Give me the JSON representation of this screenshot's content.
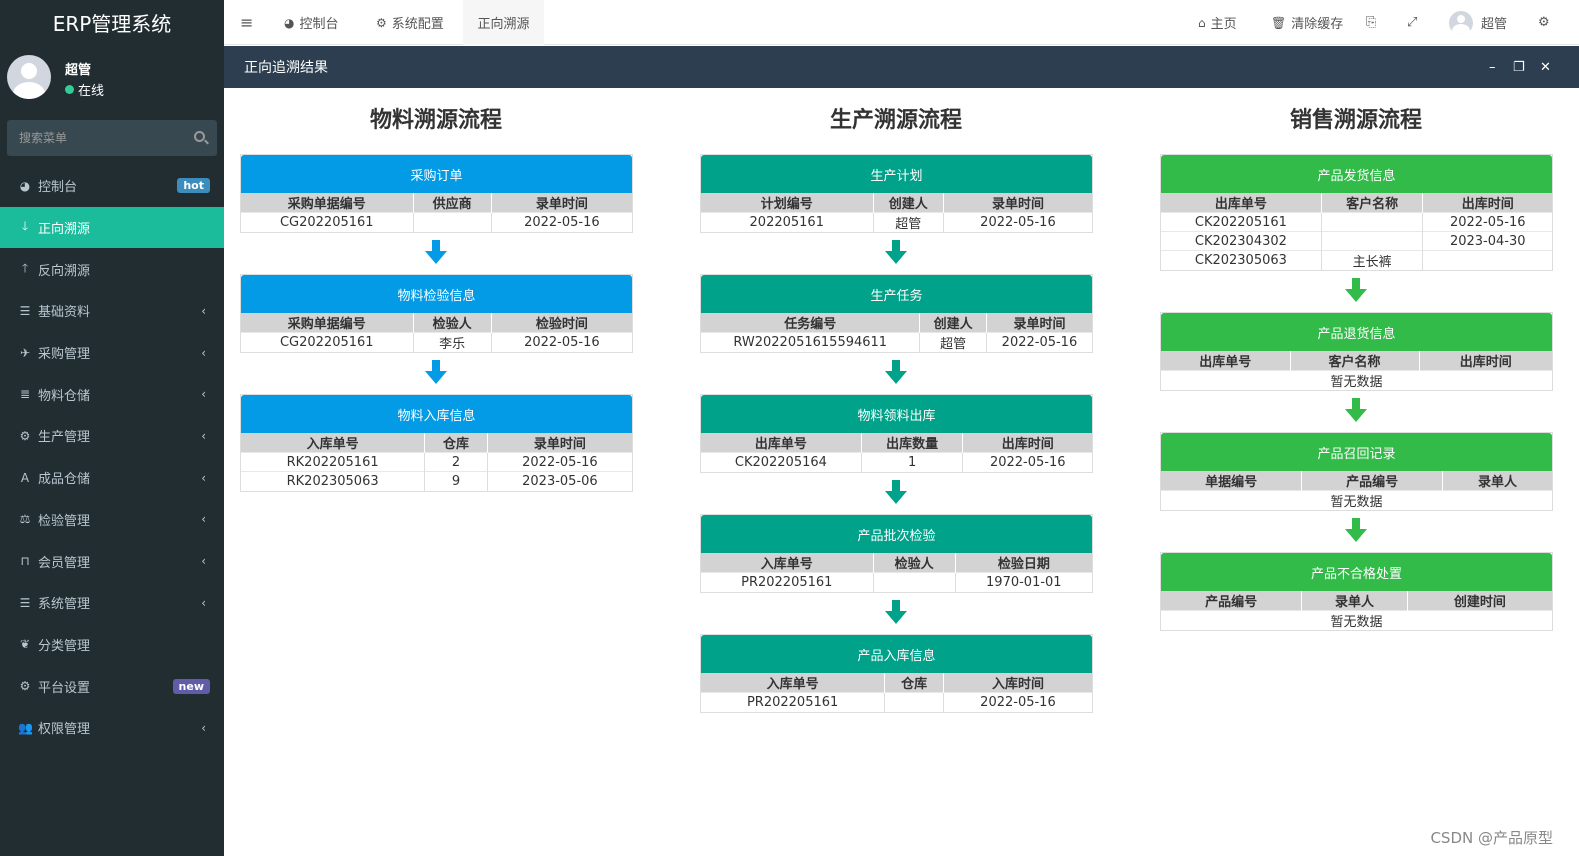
{
  "app": {
    "title": "ERP管理系统"
  },
  "user": {
    "name": "超管",
    "status": "在线"
  },
  "search": {
    "placeholder": "搜索菜单"
  },
  "menu": [
    {
      "label": "控制台",
      "icon": "dashboard-icon",
      "badge": "hot"
    },
    {
      "label": "正向溯源",
      "icon": "arrow-down-icon",
      "active": true
    },
    {
      "label": "反向溯源",
      "icon": "arrow-up-icon"
    },
    {
      "label": "基础资料",
      "icon": "list-icon"
    },
    {
      "label": "采购管理",
      "icon": "plane-icon"
    },
    {
      "label": "物料仓储",
      "icon": "database-icon"
    },
    {
      "label": "生产管理",
      "icon": "cogs-icon"
    },
    {
      "label": "成品仓储",
      "icon": "font-icon"
    },
    {
      "label": "检验管理",
      "icon": "balance-icon"
    },
    {
      "label": "会员管理",
      "icon": "lock-icon"
    },
    {
      "label": "系统管理",
      "icon": "list-icon"
    },
    {
      "label": "分类管理",
      "icon": "leaf-icon"
    },
    {
      "label": "平台设置",
      "icon": "cogs-icon",
      "badge": "new"
    },
    {
      "label": "权限管理",
      "icon": "users-icon"
    }
  ],
  "topbar": {
    "menu_toggle": "≡",
    "tabs": [
      "控制台",
      "系统配置",
      "正向溯源"
    ],
    "home": "主页",
    "clear_cache": "清除缓存",
    "user": "超管"
  },
  "window": {
    "title": "正向追溯结果"
  },
  "columns": {
    "material": "物料溯源流程",
    "production": "生产溯源流程",
    "sales": "销售溯源流程"
  },
  "cards": {
    "purchase_order": {
      "title": "采购订单",
      "headers": [
        "采购单据编号",
        "供应商",
        "录单时间"
      ],
      "rows": [
        [
          "CG202205161",
          "",
          "2022-05-16"
        ]
      ]
    },
    "material_inspection": {
      "title": "物料检验信息",
      "headers": [
        "采购单据编号",
        "检验人",
        "检验时间"
      ],
      "rows": [
        [
          "CG202205161",
          "李乐",
          "2022-05-16"
        ]
      ]
    },
    "material_inbound": {
      "title": "物料入库信息",
      "headers": [
        "入库单号",
        "仓库",
        "录单时间"
      ],
      "rows": [
        [
          "RK202205161",
          "2",
          "2022-05-16"
        ],
        [
          "RK202305063",
          "9",
          "2023-05-06"
        ]
      ]
    },
    "production_plan": {
      "title": "生产计划",
      "headers": [
        "计划编号",
        "创建人",
        "录单时间"
      ],
      "rows": [
        [
          "202205161",
          "超管",
          "2022-05-16"
        ]
      ]
    },
    "production_task": {
      "title": "生产任务",
      "headers": [
        "任务编号",
        "创建人",
        "录单时间"
      ],
      "rows": [
        [
          "RW2022051615594611",
          "超管",
          "2022-05-16"
        ]
      ]
    },
    "material_requisition": {
      "title": "物料领料出库",
      "headers": [
        "出库单号",
        "出库数量",
        "出库时间"
      ],
      "rows": [
        [
          "CK202205164",
          "1",
          "2022-05-16"
        ]
      ]
    },
    "batch_inspection": {
      "title": "产品批次检验",
      "headers": [
        "入库单号",
        "检验人",
        "检验日期"
      ],
      "rows": [
        [
          "PR202205161",
          "",
          "1970-01-01"
        ]
      ]
    },
    "product_inbound": {
      "title": "产品入库信息",
      "headers": [
        "入库单号",
        "仓库",
        "入库时间"
      ],
      "rows": [
        [
          "PR202205161",
          "",
          "2022-05-16"
        ]
      ]
    },
    "shipping_info": {
      "title": "产品发货信息",
      "headers": [
        "出库单号",
        "客户名称",
        "出库时间"
      ],
      "rows": [
        [
          "CK202205161",
          "",
          "2022-05-16"
        ],
        [
          "CK202304302",
          "",
          "2023-04-30"
        ],
        [
          "CK202305063",
          "主长裤",
          ""
        ]
      ]
    },
    "return_info": {
      "title": "产品退货信息",
      "headers": [
        "出库单号",
        "客户名称",
        "出库时间"
      ],
      "empty": "暂无数据"
    },
    "recall_record": {
      "title": "产品召回记录",
      "headers": [
        "单据编号",
        "产品编号",
        "录单人"
      ],
      "empty": "暂无数据"
    },
    "nonconforming": {
      "title": "产品不合格处置",
      "headers": [
        "产品编号",
        "录单人",
        "创建时间"
      ],
      "empty": "暂无数据"
    }
  },
  "colors": {
    "blue": "#039be5",
    "teal": "#00a28a",
    "green": "#33bb4a",
    "active_menu": "#1abc9c",
    "sidebar": "#222d32",
    "titlebar": "#2c3e50"
  },
  "watermark": "CSDN @产品原型"
}
